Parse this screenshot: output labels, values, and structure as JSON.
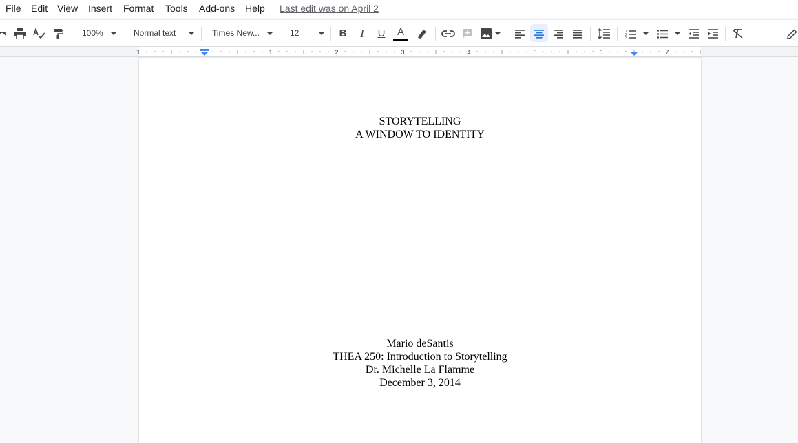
{
  "menu": {
    "items": [
      "File",
      "Edit",
      "View",
      "Insert",
      "Format",
      "Tools",
      "Add-ons",
      "Help"
    ],
    "last_edit": "Last edit was on April 2"
  },
  "toolbar": {
    "zoom": "100%",
    "style": "Normal text",
    "font": "Times New...",
    "font_size": "12",
    "bold": "B",
    "italic": "I",
    "underline": "U",
    "text_color_letter": "A",
    "text_color": "#000000",
    "active_alignment": "center",
    "accent_color": "#1a73e8"
  },
  "ruler": {
    "labels": [
      "1",
      "1",
      "2",
      "3",
      "4",
      "5",
      "6",
      "7"
    ]
  },
  "document": {
    "title_lines": [
      "STORYTELLING",
      "A WINDOW TO IDENTITY"
    ],
    "author_lines": [
      "Mario deSantis",
      "THEA 250: Introduction to Storytelling",
      "Dr. Michelle La Flamme",
      "December 3, 2014"
    ]
  }
}
